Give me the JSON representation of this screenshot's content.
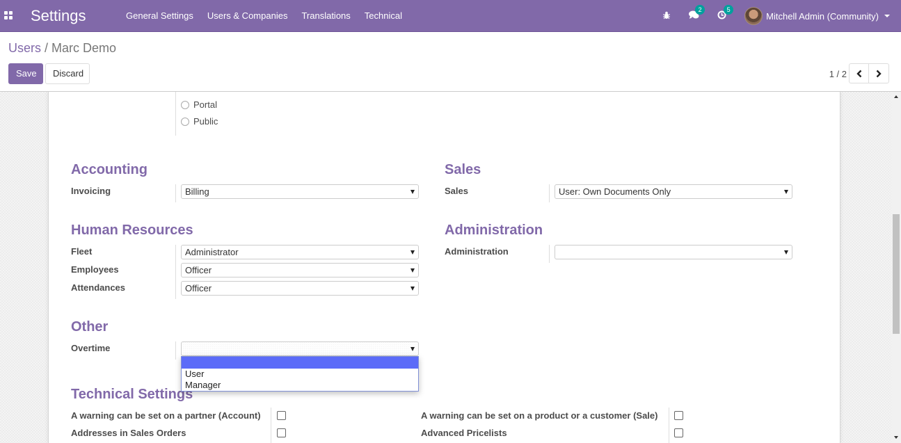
{
  "navbar": {
    "app_title": "Settings",
    "menu": [
      "General Settings",
      "Users & Companies",
      "Translations",
      "Technical"
    ],
    "systray": {
      "debug_icon": "bug-icon",
      "messages_badge": "2",
      "activities_badge": "5",
      "user_name": "Mitchell Admin (Community)"
    },
    "colors": {
      "brand": "#8169a9",
      "badge": "#00a09d"
    }
  },
  "control_panel": {
    "breadcrumb": {
      "parent": "Users",
      "separator": "/",
      "current": "Marc Demo"
    },
    "save_label": "Save",
    "discard_label": "Discard",
    "pager": {
      "value": "1 / 2",
      "prev_icon": "chevron-left-icon",
      "next_icon": "chevron-right-icon"
    }
  },
  "form": {
    "user_type_options": [
      "Portal",
      "Public"
    ],
    "sections": {
      "accounting": {
        "title": "Accounting",
        "fields": [
          {
            "label": "Invoicing",
            "value": "Billing"
          }
        ]
      },
      "sales": {
        "title": "Sales",
        "fields": [
          {
            "label": "Sales",
            "value": "User: Own Documents Only"
          }
        ]
      },
      "human_resources": {
        "title": "Human Resources",
        "fields": [
          {
            "label": "Fleet",
            "value": "Administrator"
          },
          {
            "label": "Employees",
            "value": "Officer"
          },
          {
            "label": "Attendances",
            "value": "Officer"
          }
        ]
      },
      "administration": {
        "title": "Administration",
        "fields": [
          {
            "label": "Administration",
            "value": ""
          }
        ]
      },
      "other": {
        "title": "Other",
        "fields": [
          {
            "label": "Overtime",
            "value": ""
          }
        ],
        "overtime_dropdown_options": [
          "",
          "User",
          "Manager"
        ]
      },
      "technical": {
        "title": "Technical Settings",
        "left": [
          {
            "label": "A warning can be set on a partner (Account)",
            "checked": false
          },
          {
            "label": "Addresses in Sales Orders",
            "checked": false
          }
        ],
        "right": [
          {
            "label": "A warning can be set on a product or a customer (Sale)",
            "checked": false
          },
          {
            "label": "Advanced Pricelists",
            "checked": false
          }
        ]
      }
    }
  }
}
